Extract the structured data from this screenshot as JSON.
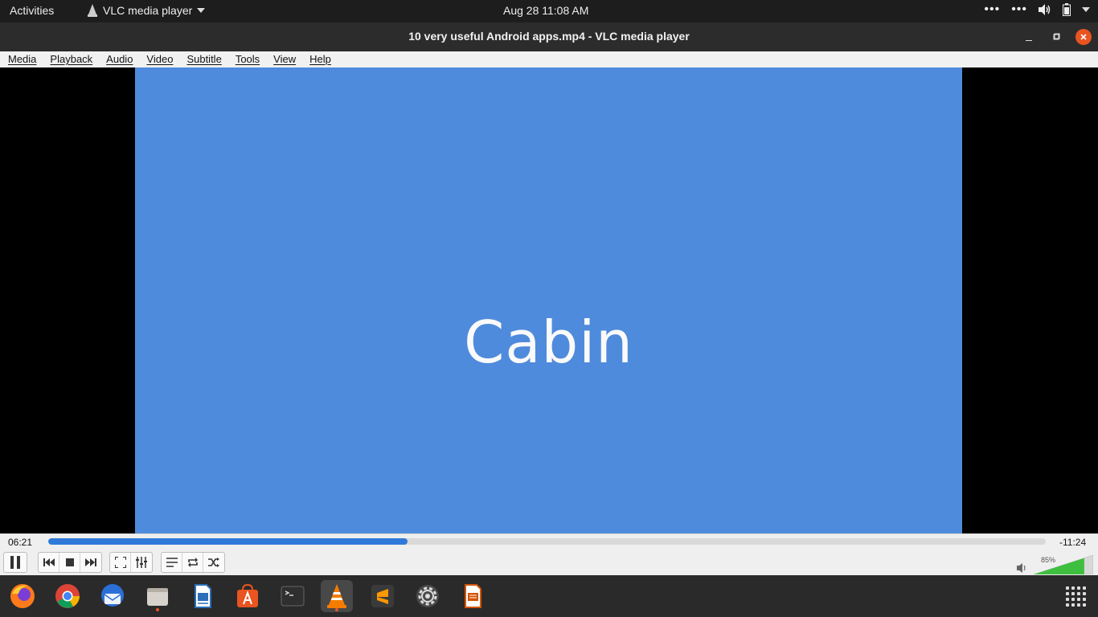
{
  "topbar": {
    "activities": "Activities",
    "app_menu": "VLC media player",
    "clock": "Aug 28  11:08 AM"
  },
  "window": {
    "title": "10 very useful Android apps.mp4 - VLC media player"
  },
  "menu": [
    "Media",
    "Playback",
    "Audio",
    "Video",
    "Subtitle",
    "Tools",
    "View",
    "Help"
  ],
  "video": {
    "caption": "Cabin",
    "background_color": "#4f8bdc"
  },
  "player": {
    "elapsed": "06:21",
    "remaining": "-11:24",
    "progress": 0.36,
    "volume_label": "85%",
    "volume": 0.85
  },
  "dock": {
    "apps": [
      "firefox-icon",
      "chrome-icon",
      "thunderbird-icon",
      "files-icon",
      "writer-icon",
      "software-icon",
      "terminal-icon",
      "vlc-icon",
      "sublime-icon",
      "settings-icon",
      "impress-icon"
    ]
  }
}
